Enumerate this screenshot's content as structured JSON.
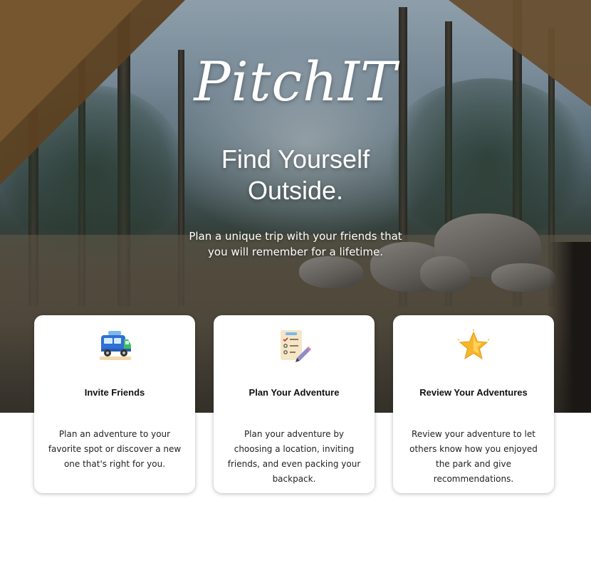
{
  "hero": {
    "logo": "PitchIT",
    "headline": "Find Yourself Outside.",
    "subhead": "Plan a unique trip with your friends that you will remember for a lifetime."
  },
  "features": [
    {
      "icon": "camper-van-icon",
      "title": "Invite Friends",
      "text": "Plan an adventure to your favorite spot or discover a new one that's right for you."
    },
    {
      "icon": "checklist-icon",
      "title": "Plan Your Adventure",
      "text": "Plan your adventure by choosing a location, inviting friends, and even packing your backpack."
    },
    {
      "icon": "star-icon",
      "title": "Review Your Adventures",
      "text": "Review your adventure to let others know how you enjoyed the park and give recommendations."
    }
  ],
  "colors": {
    "card_background": "#ffffff",
    "text": "#111111",
    "hero_text": "#ffffff"
  }
}
